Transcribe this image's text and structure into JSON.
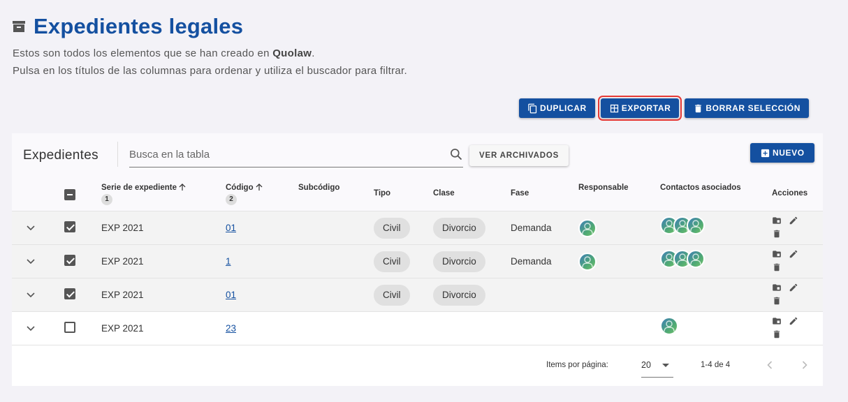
{
  "header": {
    "title": "Expedientes legales",
    "desc_line1_prefix": "Estos son todos los elementos que se han creado en ",
    "desc_brand": "Quolaw",
    "desc_line1_suffix": ".",
    "desc_line2": "Pulsa en los títulos de las columnas para ordenar y utiliza el buscador para filtrar."
  },
  "toolbar": {
    "duplicate_label": "DUPLICAR",
    "export_label": "EXPORTAR",
    "delete_selection_label": "BORRAR SELECCIÓN"
  },
  "panel": {
    "title": "Expedientes",
    "search_placeholder": "Busca en la tabla",
    "archived_label": "VER ARCHIVADOS",
    "new_label": "NUEVO"
  },
  "columns": {
    "serie": "Serie de expediente",
    "serie_sort_order": "1",
    "codigo": "Código",
    "codigo_sort_order": "2",
    "subcodigo": "Subcódigo",
    "tipo": "Tipo",
    "clase": "Clase",
    "fase": "Fase",
    "responsable": "Responsable",
    "contactos": "Contactos asociados",
    "acciones": "Acciones"
  },
  "rows": [
    {
      "serie": "EXP 2021",
      "codigo": "01",
      "tipo": "Civil",
      "clase": "Divorcio",
      "fase": "Demanda",
      "checked": true,
      "responsable_avatars": 1,
      "contact_avatars": 3
    },
    {
      "serie": "EXP 2021",
      "codigo": "1",
      "tipo": "Civil",
      "clase": "Divorcio",
      "fase": "Demanda",
      "checked": true,
      "responsable_avatars": 1,
      "contact_avatars": 3
    },
    {
      "serie": "EXP 2021",
      "codigo": "01",
      "tipo": "Civil",
      "clase": "Divorcio",
      "fase": "",
      "checked": true,
      "responsable_avatars": 0,
      "contact_avatars": 0
    },
    {
      "serie": "EXP 2021",
      "codigo": "23",
      "tipo": "",
      "clase": "",
      "fase": "",
      "checked": false,
      "responsable_avatars": 0,
      "contact_avatars": 1
    }
  ],
  "pagination": {
    "items_label": "Items por página:",
    "page_size": "20",
    "range": "1-4 de 4"
  },
  "colors": {
    "primary": "#1450a0",
    "highlight": "#e53935"
  }
}
